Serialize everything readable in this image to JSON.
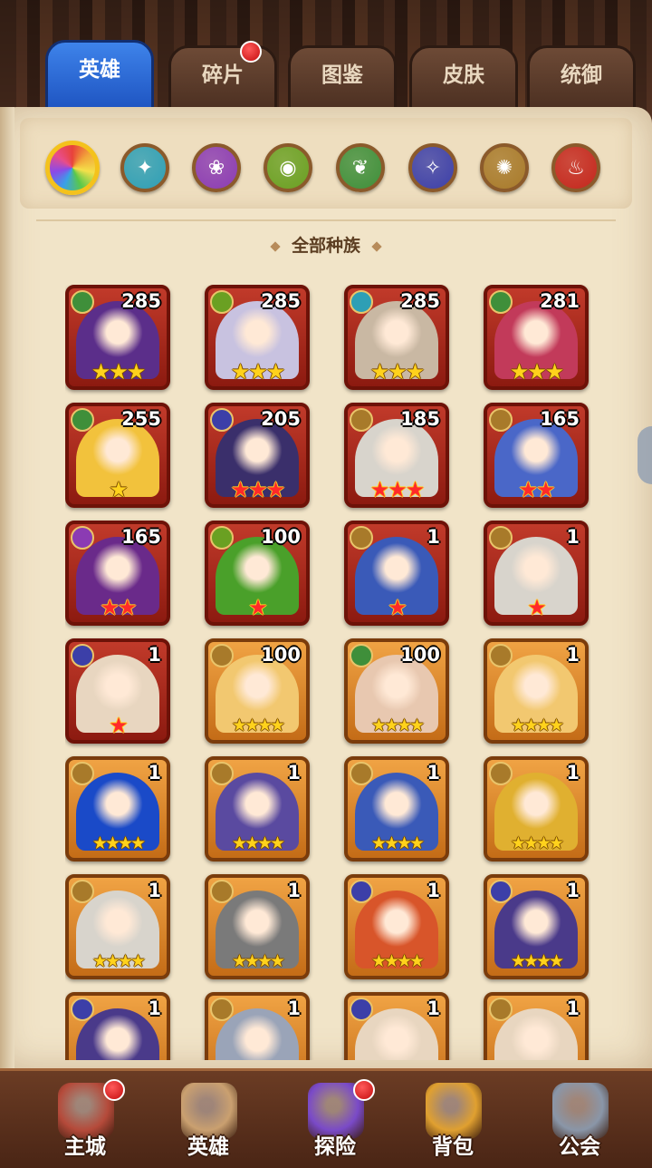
{
  "tabs": [
    {
      "label": "英雄",
      "active": true,
      "dot": false
    },
    {
      "label": "碎片",
      "active": false,
      "dot": true
    },
    {
      "label": "图鉴",
      "active": false,
      "dot": false
    },
    {
      "label": "皮肤",
      "active": false,
      "dot": false
    },
    {
      "label": "统御",
      "active": false,
      "dot": false
    }
  ],
  "races": [
    {
      "icon": "all-races-icon",
      "color": "#e84d8a",
      "active": true
    },
    {
      "icon": "water-race-icon",
      "color": "#2e9fb5",
      "active": false
    },
    {
      "icon": "purple-race-icon",
      "color": "#8b3bb3",
      "active": false
    },
    {
      "icon": "eye-race-icon",
      "color": "#6aa022",
      "active": false
    },
    {
      "icon": "leaf-race-icon",
      "color": "#3f8f3a",
      "active": false
    },
    {
      "icon": "dark-race-icon",
      "color": "#3c3fa8",
      "active": false
    },
    {
      "icon": "light-race-icon",
      "color": "#a87a2a",
      "active": false
    },
    {
      "icon": "fire-race-icon",
      "color": "#c4261c",
      "active": false
    }
  ],
  "race_title": "全部种族",
  "heroes": [
    {
      "level": "285",
      "race_color": "#3f8f3a",
      "frame": "red",
      "stars": "★★★",
      "star_style": "gold",
      "portrait": "#5b2e8a"
    },
    {
      "level": "285",
      "race_color": "#6aa022",
      "frame": "red",
      "stars": "★★★",
      "star_style": "gold",
      "portrait": "#c8c2e0"
    },
    {
      "level": "285",
      "race_color": "#2e9fb5",
      "frame": "red",
      "stars": "★★★",
      "star_style": "gold",
      "portrait": "#c9b8a3"
    },
    {
      "level": "281",
      "race_color": "#3f8f3a",
      "frame": "red",
      "stars": "★★★",
      "star_style": "gold",
      "portrait": "#c23a5a"
    },
    {
      "level": "255",
      "race_color": "#3f8f3a",
      "frame": "red",
      "stars": "★",
      "star_style": "gold",
      "portrait": "#f2c23c"
    },
    {
      "level": "205",
      "race_color": "#3c3fa8",
      "frame": "red",
      "stars": "★★★",
      "star_style": "red",
      "portrait": "#3a2f6b"
    },
    {
      "level": "185",
      "race_color": "#a87a2a",
      "frame": "red",
      "stars": "★★★",
      "star_style": "red",
      "portrait": "#d8d4cc"
    },
    {
      "level": "165",
      "race_color": "#a87a2a",
      "frame": "red",
      "stars": "★★",
      "star_style": "red",
      "portrait": "#4a67c8"
    },
    {
      "level": "165",
      "race_color": "#8b3bb3",
      "frame": "red",
      "stars": "★★",
      "star_style": "red",
      "portrait": "#6a2a8a"
    },
    {
      "level": "100",
      "race_color": "#6aa022",
      "frame": "red",
      "stars": "★",
      "star_style": "red",
      "portrait": "#4aa02a"
    },
    {
      "level": "1",
      "race_color": "#a87a2a",
      "frame": "red",
      "stars": "★",
      "star_style": "red",
      "portrait": "#3a5ab8"
    },
    {
      "level": "1",
      "race_color": "#a87a2a",
      "frame": "red",
      "stars": "★",
      "star_style": "red",
      "portrait": "#d8d4cc"
    },
    {
      "level": "1",
      "race_color": "#3c3fa8",
      "frame": "red",
      "stars": "★",
      "star_style": "red",
      "portrait": "#e8d6c0"
    },
    {
      "level": "100",
      "race_color": "#a87a2a",
      "frame": "orange",
      "stars": "★★★★",
      "star_style": "gold",
      "portrait": "#f2c870"
    },
    {
      "level": "100",
      "race_color": "#3f8f3a",
      "frame": "orange",
      "stars": "★★★★",
      "star_style": "gold",
      "portrait": "#e8c8b0"
    },
    {
      "level": "1",
      "race_color": "#a87a2a",
      "frame": "orange",
      "stars": "★★★★",
      "star_style": "gold",
      "portrait": "#f2c870"
    },
    {
      "level": "1",
      "race_color": "#a87a2a",
      "frame": "orange",
      "stars": "★★★★",
      "star_style": "gold",
      "portrait": "#1a4ac8"
    },
    {
      "level": "1",
      "race_color": "#a87a2a",
      "frame": "orange",
      "stars": "★★★★",
      "star_style": "gold",
      "portrait": "#5a4aa0"
    },
    {
      "level": "1",
      "race_color": "#a87a2a",
      "frame": "orange",
      "stars": "★★★★",
      "star_style": "gold",
      "portrait": "#3a5ab8"
    },
    {
      "level": "1",
      "race_color": "#a87a2a",
      "frame": "orange",
      "stars": "★★★★",
      "star_style": "gold",
      "portrait": "#e0b030"
    },
    {
      "level": "1",
      "race_color": "#a87a2a",
      "frame": "orange",
      "stars": "★★★★",
      "star_style": "gold",
      "portrait": "#d8d4cc"
    },
    {
      "level": "1",
      "race_color": "#a87a2a",
      "frame": "orange",
      "stars": "★★★★",
      "star_style": "gold",
      "portrait": "#7a7a7a"
    },
    {
      "level": "1",
      "race_color": "#3c3fa8",
      "frame": "orange",
      "stars": "★★★★",
      "star_style": "gold",
      "portrait": "#d8552a"
    },
    {
      "level": "1",
      "race_color": "#3c3fa8",
      "frame": "orange",
      "stars": "★★★★",
      "star_style": "gold",
      "portrait": "#4a3a8a"
    },
    {
      "level": "1",
      "race_color": "#3c3fa8",
      "frame": "orange",
      "stars": "",
      "star_style": "gold",
      "portrait": "#4a3a8a"
    },
    {
      "level": "1",
      "race_color": "#a87a2a",
      "frame": "orange",
      "stars": "",
      "star_style": "gold",
      "portrait": "#9aa4b8"
    },
    {
      "level": "1",
      "race_color": "#3c3fa8",
      "frame": "orange",
      "stars": "",
      "star_style": "gold",
      "portrait": "#e8d6c0"
    },
    {
      "level": "1",
      "race_color": "#a87a2a",
      "frame": "orange",
      "stars": "",
      "star_style": "gold",
      "portrait": "#e8d6c0"
    }
  ],
  "nav": [
    {
      "label": "主城",
      "icon": "castle-icon",
      "color": "#b54a3a",
      "dot": true
    },
    {
      "label": "英雄",
      "icon": "hero-portrait-icon",
      "color": "#caa070",
      "dot": false
    },
    {
      "label": "探险",
      "icon": "portal-icon",
      "color": "#7a4ac8",
      "dot": true
    },
    {
      "label": "背包",
      "icon": "backpack-icon",
      "color": "#e0a030",
      "dot": false
    },
    {
      "label": "公会",
      "icon": "guild-tower-icon",
      "color": "#8a96a8",
      "dot": false
    }
  ]
}
